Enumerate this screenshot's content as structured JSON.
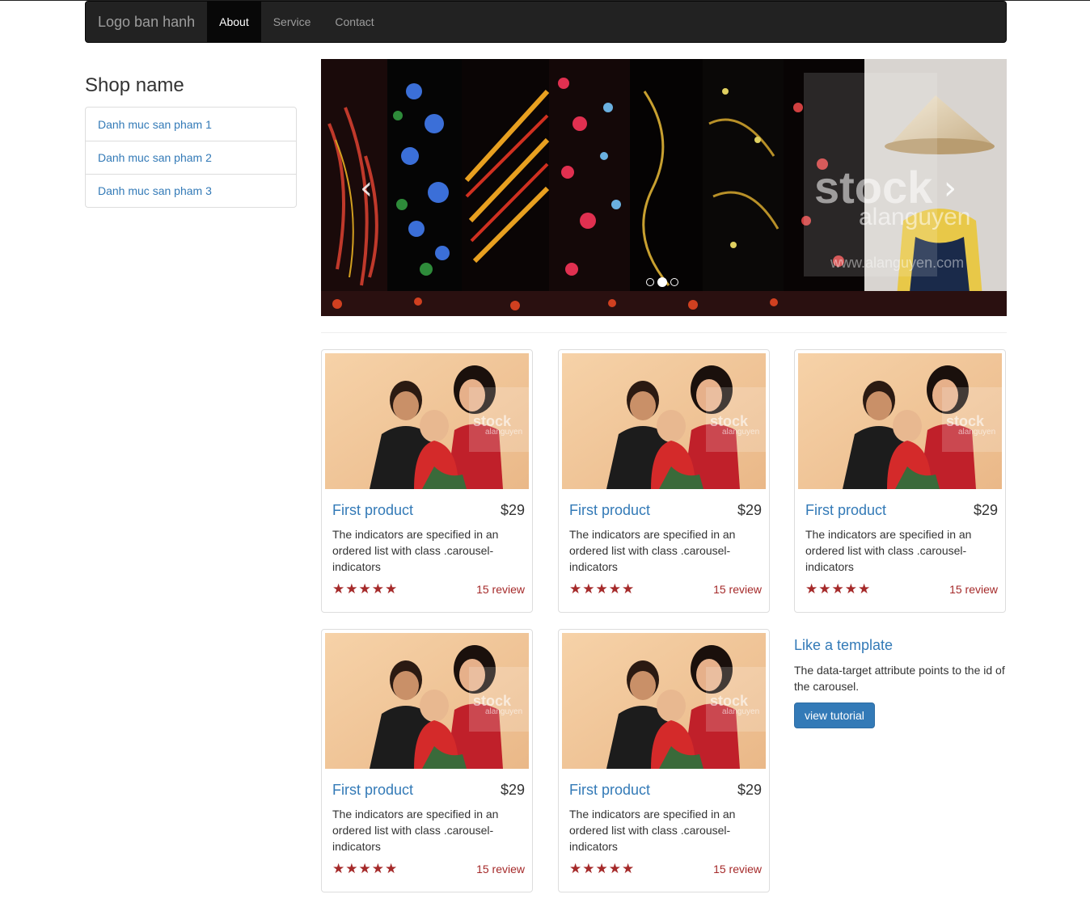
{
  "navbar": {
    "brand": "Logo ban hanh",
    "items": [
      {
        "label": "About",
        "active": true
      },
      {
        "label": "Service",
        "active": false
      },
      {
        "label": "Contact",
        "active": false
      }
    ]
  },
  "sidebar": {
    "title": "Shop name",
    "items": [
      {
        "label": "Danh muc san pham 1"
      },
      {
        "label": "Danh muc san pham 2"
      },
      {
        "label": "Danh muc san pham 3"
      }
    ]
  },
  "carousel": {
    "prev_icon": "chevron-left-icon",
    "next_icon": "chevron-right-icon",
    "prev_glyph": "‹",
    "next_glyph": "›",
    "slide_count": 3,
    "active_slide": 2
  },
  "products": [
    {
      "name": "First product",
      "price": "$29",
      "description": "The indicators are specified in an ordered list with class .carousel-indicators",
      "stars": "★★★★★",
      "rating": 5,
      "reviews": "15 review"
    },
    {
      "name": "First product",
      "price": "$29",
      "description": "The indicators are specified in an ordered list with class .carousel-indicators",
      "stars": "★★★★★",
      "rating": 5,
      "reviews": "15 review"
    },
    {
      "name": "First product",
      "price": "$29",
      "description": "The indicators are specified in an ordered list with class .carousel-indicators",
      "stars": "★★★★★",
      "rating": 5,
      "reviews": "15 review"
    },
    {
      "name": "First product",
      "price": "$29",
      "description": "The indicators are specified in an ordered list with class .carousel-indicators",
      "stars": "★★★★★",
      "rating": 5,
      "reviews": "15 review"
    },
    {
      "name": "First product",
      "price": "$29",
      "description": "The indicators are specified in an ordered list with class .carousel-indicators",
      "stars": "★★★★★",
      "rating": 5,
      "reviews": "15 review"
    }
  ],
  "template_box": {
    "title": "Like a template",
    "text": "The data-target attribute points to the id of the carousel.",
    "button": "view tutorial"
  },
  "colors": {
    "navbar_bg": "#222222",
    "link": "#337ab7",
    "rating": "#a52a2a",
    "button": "#337ab7"
  }
}
